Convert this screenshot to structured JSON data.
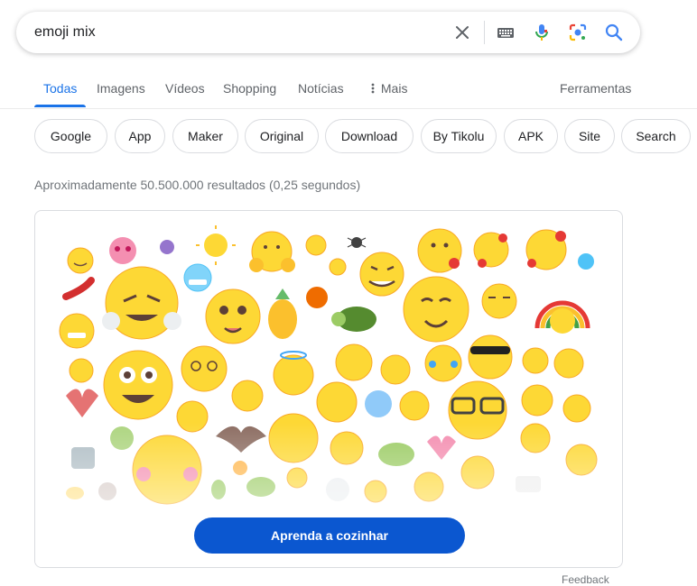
{
  "search": {
    "query": "emoji mix"
  },
  "tabs": [
    {
      "label": "Todas",
      "active": true
    },
    {
      "label": "Imagens"
    },
    {
      "label": "Vídeos"
    },
    {
      "label": "Shopping"
    },
    {
      "label": "Notícias"
    },
    {
      "label": "Mais"
    }
  ],
  "tools_label": "Ferramentas",
  "chips": [
    "Google",
    "App",
    "Maker",
    "Original",
    "Download",
    "By Tikolu",
    "APK",
    "Site",
    "Search"
  ],
  "stats": "Aproximadamente 50.500.000 resultados (0,25 segundos)",
  "card": {
    "button_label": "Aprenda a cozinhar"
  },
  "feedback_label": "Feedback",
  "icons": [
    "clear-icon",
    "keyboard-icon",
    "microphone-icon",
    "lens-icon",
    "search-icon",
    "more-dots-icon"
  ],
  "colors": {
    "accent": "#1a73e8",
    "button": "#0b57d0",
    "emoji_yellow": "#fbc02d",
    "emoji_face": "#fdd835"
  }
}
